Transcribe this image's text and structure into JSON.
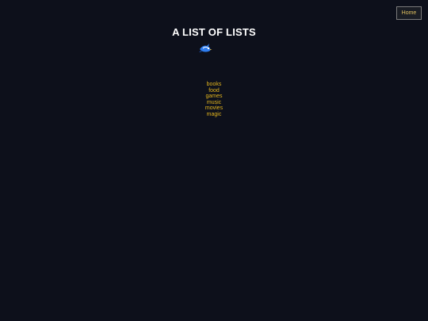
{
  "header": {
    "home_label": "Home",
    "title": "A LIST OF LISTS",
    "logo_icon": "bird-icon"
  },
  "lists": [
    {
      "label": "books"
    },
    {
      "label": "food"
    },
    {
      "label": "games"
    },
    {
      "label": "music"
    },
    {
      "label": "movies"
    },
    {
      "label": "magic"
    }
  ],
  "colors": {
    "background": "#0d101b",
    "link": "#e3b51d",
    "title": "#ffffff",
    "button_border": "#7b7b7b"
  }
}
